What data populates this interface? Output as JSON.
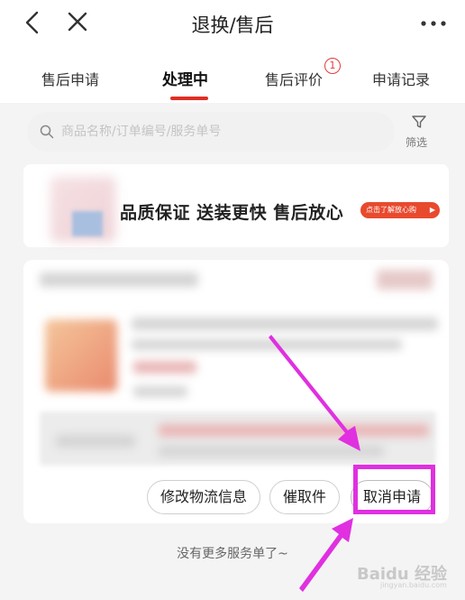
{
  "header": {
    "title": "退换/售后",
    "back_icon": "chevron-left-icon",
    "close_icon": "close-icon",
    "more_icon": "more-dots-icon"
  },
  "tabs": [
    {
      "label": "售后申请",
      "active": false
    },
    {
      "label": "处理中",
      "active": true
    },
    {
      "label": "售后评价",
      "active": false,
      "badge": "1"
    },
    {
      "label": "申请记录",
      "active": false
    }
  ],
  "search": {
    "placeholder": "商品名称/订单编号/服务单号",
    "filter_label": "筛选"
  },
  "banner": {
    "slogan": "品质保证  送装更快  售后放心",
    "button_label": "点击了解放心购",
    "button_arrow": "▶"
  },
  "card": {
    "actions": [
      "修改物流信息",
      "催取件",
      "取消申请"
    ]
  },
  "footer": {
    "end_text": "没有更多服务单了~"
  },
  "watermark": {
    "text": "Baidu 经验",
    "sub": "jingyan.baidu.com"
  },
  "colors": {
    "accent": "#e02e24",
    "annotation": "#e030e0"
  }
}
